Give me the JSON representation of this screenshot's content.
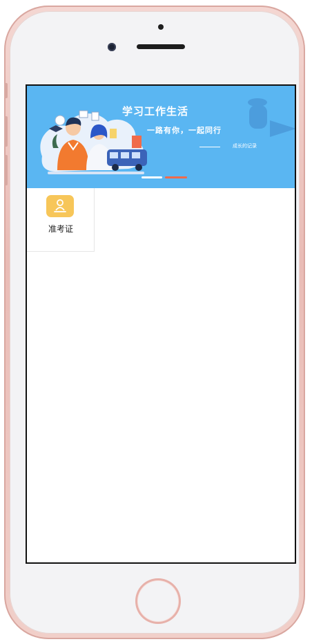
{
  "banner": {
    "title": "学习工作生活",
    "subtitle": "一路有你，一起同行",
    "note": "成长的记录",
    "carousel": {
      "active_index": 1,
      "count": 2,
      "active_color": "#ef6a4b",
      "bg_color": "#5ab6f2"
    }
  },
  "grid": {
    "items": [
      {
        "label": "准考证",
        "icon": "admission-ticket-icon",
        "icon_bg": "#f7c659"
      }
    ]
  },
  "device": {
    "frame_color": "#f4d7d2"
  }
}
